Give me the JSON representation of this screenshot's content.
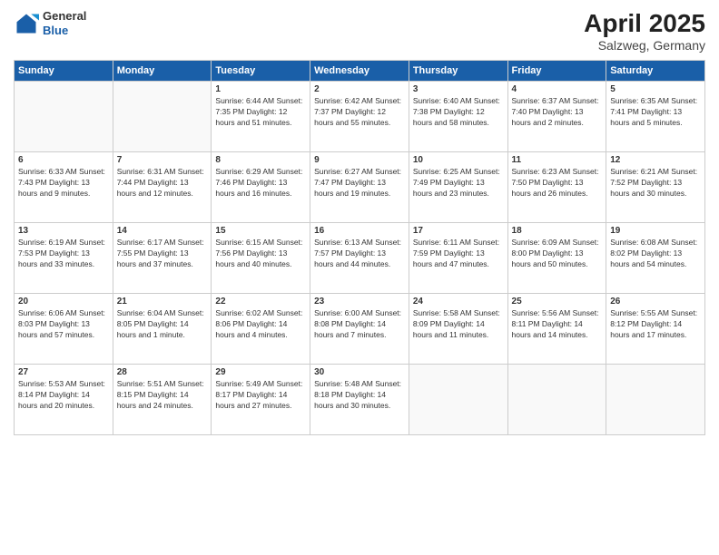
{
  "header": {
    "logo": {
      "general": "General",
      "blue": "Blue"
    },
    "title": "April 2025",
    "subtitle": "Salzweg, Germany"
  },
  "weekdays": [
    "Sunday",
    "Monday",
    "Tuesday",
    "Wednesday",
    "Thursday",
    "Friday",
    "Saturday"
  ],
  "weeks": [
    [
      {
        "day": "",
        "info": ""
      },
      {
        "day": "",
        "info": ""
      },
      {
        "day": "1",
        "info": "Sunrise: 6:44 AM\nSunset: 7:35 PM\nDaylight: 12 hours and 51 minutes."
      },
      {
        "day": "2",
        "info": "Sunrise: 6:42 AM\nSunset: 7:37 PM\nDaylight: 12 hours and 55 minutes."
      },
      {
        "day": "3",
        "info": "Sunrise: 6:40 AM\nSunset: 7:38 PM\nDaylight: 12 hours and 58 minutes."
      },
      {
        "day": "4",
        "info": "Sunrise: 6:37 AM\nSunset: 7:40 PM\nDaylight: 13 hours and 2 minutes."
      },
      {
        "day": "5",
        "info": "Sunrise: 6:35 AM\nSunset: 7:41 PM\nDaylight: 13 hours and 5 minutes."
      }
    ],
    [
      {
        "day": "6",
        "info": "Sunrise: 6:33 AM\nSunset: 7:43 PM\nDaylight: 13 hours and 9 minutes."
      },
      {
        "day": "7",
        "info": "Sunrise: 6:31 AM\nSunset: 7:44 PM\nDaylight: 13 hours and 12 minutes."
      },
      {
        "day": "8",
        "info": "Sunrise: 6:29 AM\nSunset: 7:46 PM\nDaylight: 13 hours and 16 minutes."
      },
      {
        "day": "9",
        "info": "Sunrise: 6:27 AM\nSunset: 7:47 PM\nDaylight: 13 hours and 19 minutes."
      },
      {
        "day": "10",
        "info": "Sunrise: 6:25 AM\nSunset: 7:49 PM\nDaylight: 13 hours and 23 minutes."
      },
      {
        "day": "11",
        "info": "Sunrise: 6:23 AM\nSunset: 7:50 PM\nDaylight: 13 hours and 26 minutes."
      },
      {
        "day": "12",
        "info": "Sunrise: 6:21 AM\nSunset: 7:52 PM\nDaylight: 13 hours and 30 minutes."
      }
    ],
    [
      {
        "day": "13",
        "info": "Sunrise: 6:19 AM\nSunset: 7:53 PM\nDaylight: 13 hours and 33 minutes."
      },
      {
        "day": "14",
        "info": "Sunrise: 6:17 AM\nSunset: 7:55 PM\nDaylight: 13 hours and 37 minutes."
      },
      {
        "day": "15",
        "info": "Sunrise: 6:15 AM\nSunset: 7:56 PM\nDaylight: 13 hours and 40 minutes."
      },
      {
        "day": "16",
        "info": "Sunrise: 6:13 AM\nSunset: 7:57 PM\nDaylight: 13 hours and 44 minutes."
      },
      {
        "day": "17",
        "info": "Sunrise: 6:11 AM\nSunset: 7:59 PM\nDaylight: 13 hours and 47 minutes."
      },
      {
        "day": "18",
        "info": "Sunrise: 6:09 AM\nSunset: 8:00 PM\nDaylight: 13 hours and 50 minutes."
      },
      {
        "day": "19",
        "info": "Sunrise: 6:08 AM\nSunset: 8:02 PM\nDaylight: 13 hours and 54 minutes."
      }
    ],
    [
      {
        "day": "20",
        "info": "Sunrise: 6:06 AM\nSunset: 8:03 PM\nDaylight: 13 hours and 57 minutes."
      },
      {
        "day": "21",
        "info": "Sunrise: 6:04 AM\nSunset: 8:05 PM\nDaylight: 14 hours and 1 minute."
      },
      {
        "day": "22",
        "info": "Sunrise: 6:02 AM\nSunset: 8:06 PM\nDaylight: 14 hours and 4 minutes."
      },
      {
        "day": "23",
        "info": "Sunrise: 6:00 AM\nSunset: 8:08 PM\nDaylight: 14 hours and 7 minutes."
      },
      {
        "day": "24",
        "info": "Sunrise: 5:58 AM\nSunset: 8:09 PM\nDaylight: 14 hours and 11 minutes."
      },
      {
        "day": "25",
        "info": "Sunrise: 5:56 AM\nSunset: 8:11 PM\nDaylight: 14 hours and 14 minutes."
      },
      {
        "day": "26",
        "info": "Sunrise: 5:55 AM\nSunset: 8:12 PM\nDaylight: 14 hours and 17 minutes."
      }
    ],
    [
      {
        "day": "27",
        "info": "Sunrise: 5:53 AM\nSunset: 8:14 PM\nDaylight: 14 hours and 20 minutes."
      },
      {
        "day": "28",
        "info": "Sunrise: 5:51 AM\nSunset: 8:15 PM\nDaylight: 14 hours and 24 minutes."
      },
      {
        "day": "29",
        "info": "Sunrise: 5:49 AM\nSunset: 8:17 PM\nDaylight: 14 hours and 27 minutes."
      },
      {
        "day": "30",
        "info": "Sunrise: 5:48 AM\nSunset: 8:18 PM\nDaylight: 14 hours and 30 minutes."
      },
      {
        "day": "",
        "info": ""
      },
      {
        "day": "",
        "info": ""
      },
      {
        "day": "",
        "info": ""
      }
    ]
  ]
}
